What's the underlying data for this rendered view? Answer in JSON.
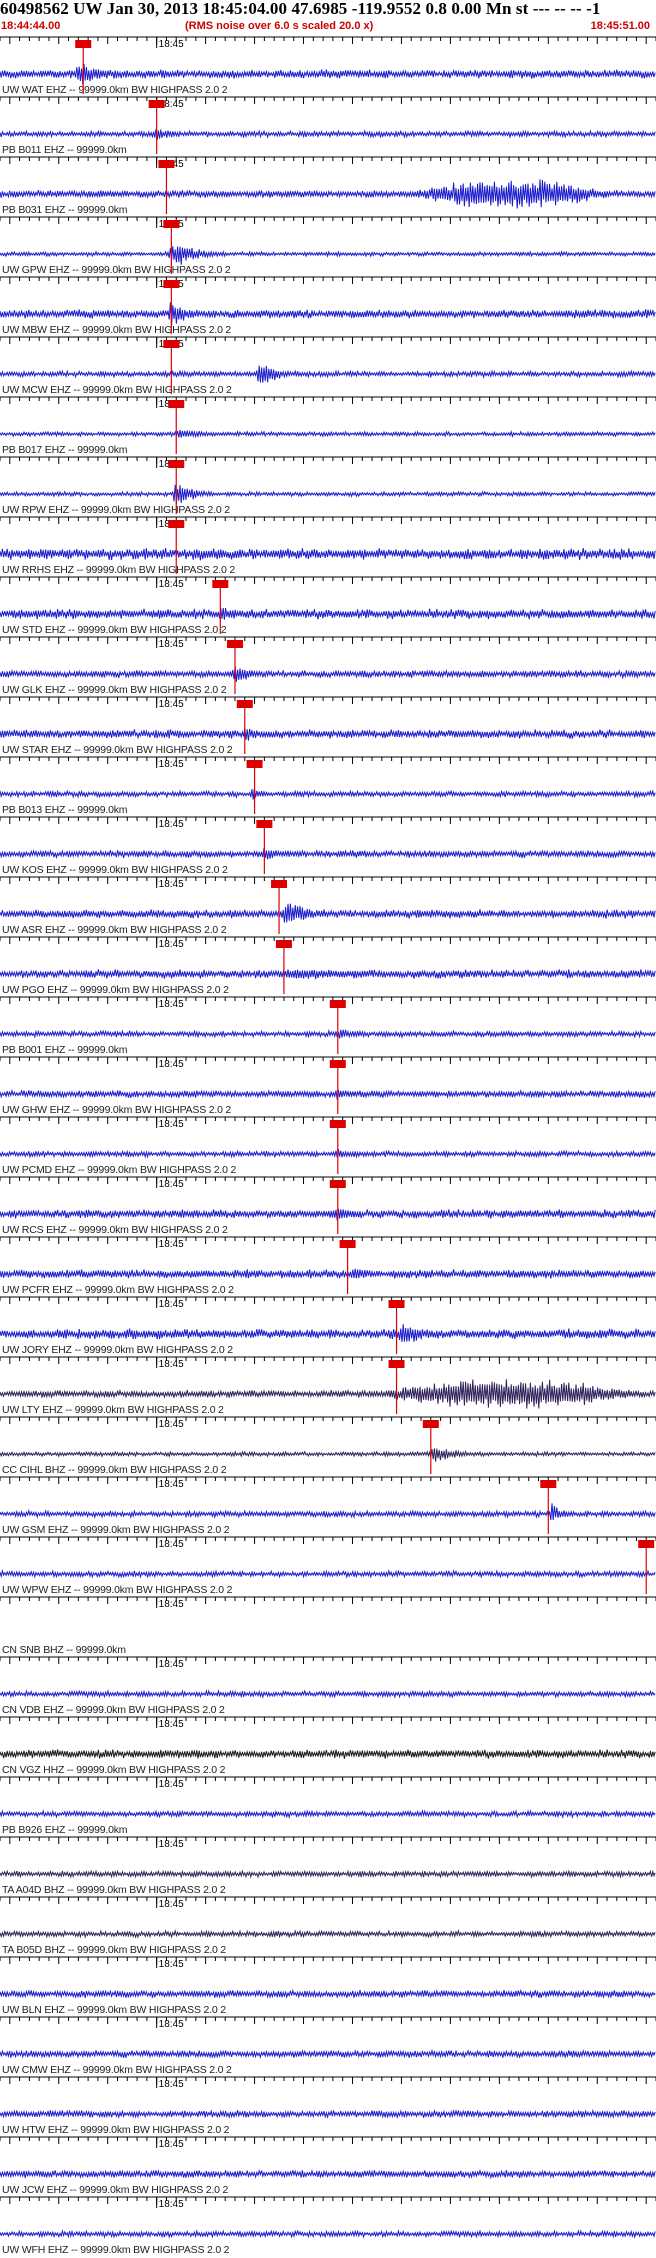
{
  "header": {
    "title": "60498562 UW Jan 30, 2013 18:45:04.00   47.6985 -119.9552  0.8 0.00 Mn st --- -- --  -1",
    "start_time": "18:44:44.00",
    "end_time": "18:45:51.00",
    "note": "(RMS noise over 6.0 s scaled 20.0 x)"
  },
  "chart_data": {
    "type": "line",
    "x_range": [
      "18:44:44.00",
      "18:45:51.00"
    ],
    "minute_tick_label": "18:45",
    "minute_tick_time": "18:45:00",
    "trace_color": "#1a1acc",
    "pick_color": "#dd0000",
    "series": [
      {
        "label": "UW WAT EHZ -- 99999.0km BW  HIGHPASS  2.0  2",
        "color": "#1a1acc",
        "pick": "18:44:52.5",
        "amp": 0.3,
        "event": {
          "start": "18:44:51.5",
          "dur_s": 4,
          "amp": 0.9
        }
      },
      {
        "label": "PB B011 EHZ -- 99999.0km",
        "color": "#1a1acc",
        "pick": "18:45:00.0",
        "amp": 0.2,
        "event": {
          "start": "18:44:59.5",
          "dur_s": 3,
          "amp": 0.5
        }
      },
      {
        "label": "PB B031 EHZ -- 99999.0km",
        "color": "#1a1acc",
        "pick": "18:45:01.0",
        "amp": 0.25,
        "event": {
          "start": "18:45:25.0",
          "dur_s": 22,
          "amp": 1.0
        }
      },
      {
        "label": "UW GPW EHZ -- 99999.0km BW  HIGHPASS  2.0  2",
        "color": "#1a1acc",
        "pick": "18:45:01.5",
        "amp": 0.15,
        "event": {
          "start": "18:45:01.0",
          "dur_s": 4,
          "amp": 1.0
        }
      },
      {
        "label": "UW MBW EHZ -- 99999.0km BW  HIGHPASS  2.0  2",
        "color": "#1a1acc",
        "pick": "18:45:01.5",
        "amp": 0.3,
        "event": {
          "start": "18:45:01.0",
          "dur_s": 3,
          "amp": 1.0
        }
      },
      {
        "label": "UW MCW EHZ -- 99999.0km BW  HIGHPASS  2.0  2",
        "color": "#1a1acc",
        "pick": "18:45:01.5",
        "amp": 0.2,
        "event": {
          "start": "18:45:10.0",
          "dur_s": 3,
          "amp": 1.0
        }
      },
      {
        "label": "PB B017 EHZ -- 99999.0km",
        "color": "#1a1acc",
        "pick": "18:45:02.0",
        "amp": 0.15,
        "event": {
          "start": "18:45:01.5",
          "dur_s": 5,
          "amp": 0.4
        }
      },
      {
        "label": "UW RPW EHZ -- 99999.0km BW  HIGHPASS  2.0  2",
        "color": "#1a1acc",
        "pick": "18:45:02.0",
        "amp": 0.15,
        "event": {
          "start": "18:45:01.5",
          "dur_s": 3,
          "amp": 1.0
        }
      },
      {
        "label": "UW RRHS EHZ -- 99999.0km BW  HIGHPASS  2.0  2",
        "color": "#1a1acc",
        "pick": "18:45:02.0",
        "amp": 0.4,
        "event": {
          "start": "18:45:03.0",
          "dur_s": 6,
          "amp": 0.5
        }
      },
      {
        "label": "UW STD EHZ -- 99999.0km BW  HIGHPASS  2.0  2",
        "color": "#1a1acc",
        "pick": "18:45:06.5",
        "amp": 0.35,
        "event": {
          "start": "18:45:06.0",
          "dur_s": 4,
          "amp": 0.6
        }
      },
      {
        "label": "UW GLK EHZ -- 99999.0km BW  HIGHPASS  2.0  2",
        "color": "#1a1acc",
        "pick": "18:45:08.0",
        "amp": 0.25,
        "event": {
          "start": "18:45:07.5",
          "dur_s": 3,
          "amp": 0.7
        }
      },
      {
        "label": "UW STAR EHZ -- 99999.0km BW  HIGHPASS  2.0  2",
        "color": "#1a1acc",
        "pick": "18:45:09.0",
        "amp": 0.3,
        "event": {
          "start": "18:45:08.5",
          "dur_s": 4,
          "amp": 0.5
        }
      },
      {
        "label": "PB B013 EHZ -- 99999.0km",
        "color": "#1a1acc",
        "pick": "18:45:10.0",
        "amp": 0.2,
        "event": {
          "start": "18:45:09.5",
          "dur_s": 2,
          "amp": 0.6
        }
      },
      {
        "label": "UW KOS EHZ -- 99999.0km BW  HIGHPASS  2.0  2",
        "color": "#1a1acc",
        "pick": "18:45:11.0",
        "amp": 0.25,
        "event": {
          "start": "18:45:10.5",
          "dur_s": 3,
          "amp": 0.5
        }
      },
      {
        "label": "UW ASR EHZ -- 99999.0km BW  HIGHPASS  2.0  2",
        "color": "#1a1acc",
        "pick": "18:45:12.5",
        "amp": 0.3,
        "event": {
          "start": "18:45:12.5",
          "dur_s": 4,
          "amp": 1.0
        }
      },
      {
        "label": "UW PGO EHZ -- 99999.0km BW  HIGHPASS  2.0  2",
        "color": "#1a1acc",
        "pick": "18:45:13.0",
        "amp": 0.3,
        "event": {
          "start": "18:45:12.0",
          "dur_s": 14,
          "amp": 0.45
        }
      },
      {
        "label": "PB B001 EHZ -- 99999.0km",
        "color": "#1a1acc",
        "pick": "18:45:18.5",
        "amp": 0.2,
        "event": {
          "start": "18:45:18.0",
          "dur_s": 4,
          "amp": 0.4
        }
      },
      {
        "label": "UW GHW EHZ -- 99999.0km BW  HIGHPASS  2.0  2",
        "color": "#1a1acc",
        "pick": "18:45:18.5",
        "amp": 0.25,
        "event": {
          "start": "18:45:18.0",
          "dur_s": 3,
          "amp": 0.4
        }
      },
      {
        "label": "UW PCMD EHZ -- 99999.0km BW  HIGHPASS  2.0  2",
        "color": "#1a1acc",
        "pick": "18:45:18.5",
        "amp": 0.2,
        "event": {
          "start": "18:45:18.0",
          "dur_s": 3,
          "amp": 0.4
        }
      },
      {
        "label": "UW RCS EHZ -- 99999.0km BW  HIGHPASS  2.0  2",
        "color": "#1a1acc",
        "pick": "18:45:18.5",
        "amp": 0.3,
        "event": {
          "start": "18:45:18.0",
          "dur_s": 3,
          "amp": 0.6
        }
      },
      {
        "label": "UW PCFR EHZ -- 99999.0km BW  HIGHPASS  2.0  2",
        "color": "#1a1acc",
        "pick": "18:45:19.5",
        "amp": 0.3,
        "event": {
          "start": "18:45:19.5",
          "dur_s": 4,
          "amp": 0.5
        }
      },
      {
        "label": "UW JORY EHZ -- 99999.0km BW  HIGHPASS  2.0  2",
        "color": "#1a1acc",
        "pick": "18:45:24.5",
        "amp": 0.35,
        "event": {
          "start": "18:45:24.5",
          "dur_s": 4,
          "amp": 0.9
        }
      },
      {
        "label": "UW LTY EHZ -- 99999.0km BW  HIGHPASS  2.0  2",
        "color": "#30205a",
        "pick": "18:45:24.5",
        "amp": 0.25,
        "event": {
          "start": "18:45:21.0",
          "dur_s": 30,
          "amp": 1.0
        }
      },
      {
        "label": "CC CIHL BHZ -- 99999.0km BW  HIGHPASS  2.0  2",
        "color": "#30205a",
        "pick": "18:45:28.0",
        "amp": 0.15,
        "event": {
          "start": "18:45:27.5",
          "dur_s": 5,
          "amp": 0.6
        }
      },
      {
        "label": "UW GSM EHZ -- 99999.0km BW  HIGHPASS  2.0  2",
        "color": "#1a1acc",
        "pick": "18:45:40.0",
        "amp": 0.2,
        "event": {
          "start": "18:45:40.0",
          "dur_s": 2,
          "amp": 0.9
        }
      },
      {
        "label": "UW WPW EHZ -- 99999.0km BW  HIGHPASS  2.0  2",
        "color": "#1a1acc",
        "pick": "18:45:50.0",
        "amp": 0.2,
        "event": null
      },
      {
        "label": "CN SNB BHZ -- 99999.0km",
        "color": "#1a1acc",
        "pick": null,
        "amp": 0.0,
        "event": null
      },
      {
        "label": "CN VDB EHZ -- 99999.0km BW  HIGHPASS  2.0  2",
        "color": "#1a1acc",
        "pick": null,
        "amp": 0.2,
        "event": null
      },
      {
        "label": "CN VGZ HHZ -- 99999.0km BW  HIGHPASS  2.0  2",
        "color": "#1a1a1a",
        "pick": null,
        "amp": 0.3,
        "event": null
      },
      {
        "label": "PB B926 EHZ -- 99999.0km",
        "color": "#1a1acc",
        "pick": null,
        "amp": 0.2,
        "event": null
      },
      {
        "label": "TA A04D BHZ -- 99999.0km BW  HIGHPASS  2.0  2",
        "color": "#30205a",
        "pick": null,
        "amp": 0.2,
        "event": null
      },
      {
        "label": "TA B05D BHZ -- 99999.0km BW  HIGHPASS  2.0  2",
        "color": "#30205a",
        "pick": null,
        "amp": 0.2,
        "event": null
      },
      {
        "label": "UW BLN EHZ -- 99999.0km BW  HIGHPASS  2.0  2",
        "color": "#1a1acc",
        "pick": null,
        "amp": 0.25,
        "event": null
      },
      {
        "label": "UW CMW EHZ -- 99999.0km BW  HIGHPASS  2.0  2",
        "color": "#1a1acc",
        "pick": null,
        "amp": 0.25,
        "event": null
      },
      {
        "label": "UW HTW EHZ -- 99999.0km BW  HIGHPASS  2.0  2",
        "color": "#1a1acc",
        "pick": null,
        "amp": 0.25,
        "event": null
      },
      {
        "label": "UW JCW EHZ -- 99999.0km BW  HIGHPASS  2.0  2",
        "color": "#1a1acc",
        "pick": null,
        "amp": 0.25,
        "event": null
      },
      {
        "label": "UW WFH EHZ -- 99999.0km BW  HIGHPASS  2.0  2",
        "color": "#1a1acc",
        "pick": null,
        "amp": 0.2,
        "event": null
      }
    ]
  }
}
